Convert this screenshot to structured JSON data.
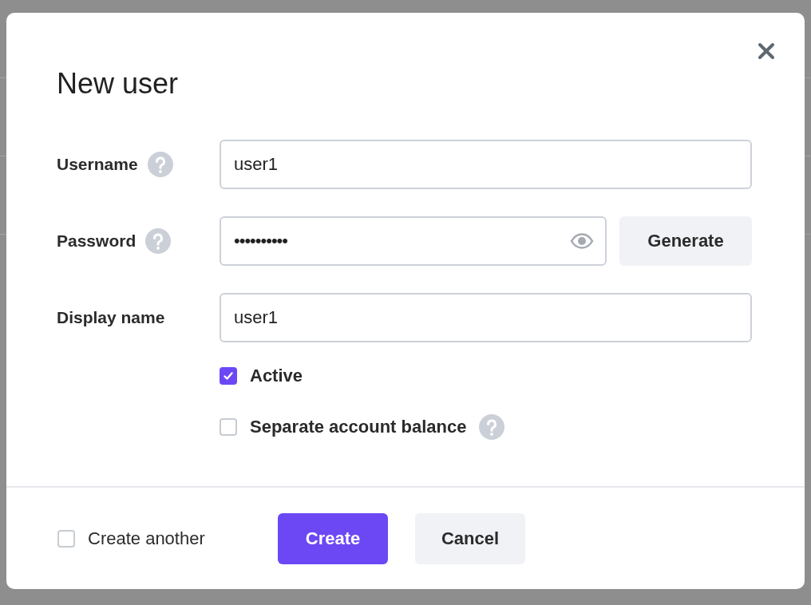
{
  "dialog": {
    "title": "New user",
    "fields": [
      {
        "kind": "text",
        "label": "Username",
        "help": true,
        "value": "user1"
      },
      {
        "kind": "password",
        "label": "Password",
        "help": true,
        "value": "••••••••••",
        "button": "Generate"
      },
      {
        "kind": "text",
        "label": "Display name",
        "help": false,
        "value": "user1"
      }
    ],
    "options": [
      {
        "label": "Active",
        "checked": true,
        "help": false
      },
      {
        "label": "Separate account balance",
        "checked": false,
        "help": true
      }
    ],
    "footer": {
      "create_another": {
        "label": "Create another",
        "checked": false
      },
      "buttons": [
        {
          "label": "Create",
          "kind": "primary"
        },
        {
          "label": "Cancel",
          "kind": "secondary"
        }
      ]
    }
  }
}
